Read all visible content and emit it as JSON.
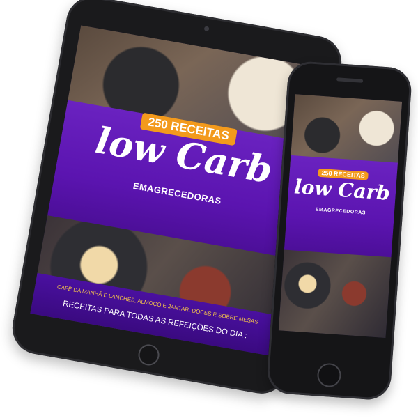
{
  "cover": {
    "badge": "250 RECEITAS",
    "title": "low Carb",
    "subtitle": "EMAGRECEDORAS",
    "tagline": "CAFÉ DA MANHÃ E LANCHES, ALMOÇO E JANTAR, DOCES E SOBRE MESAS",
    "cta": "RECEITAS PARA TODAS AS REFEIÇÕES DO DIA :"
  },
  "colors": {
    "purple": "#5b14b0",
    "orange": "#f39a1c",
    "tagline_yellow": "#f7c64a",
    "device_body": "#1a1a1c"
  }
}
